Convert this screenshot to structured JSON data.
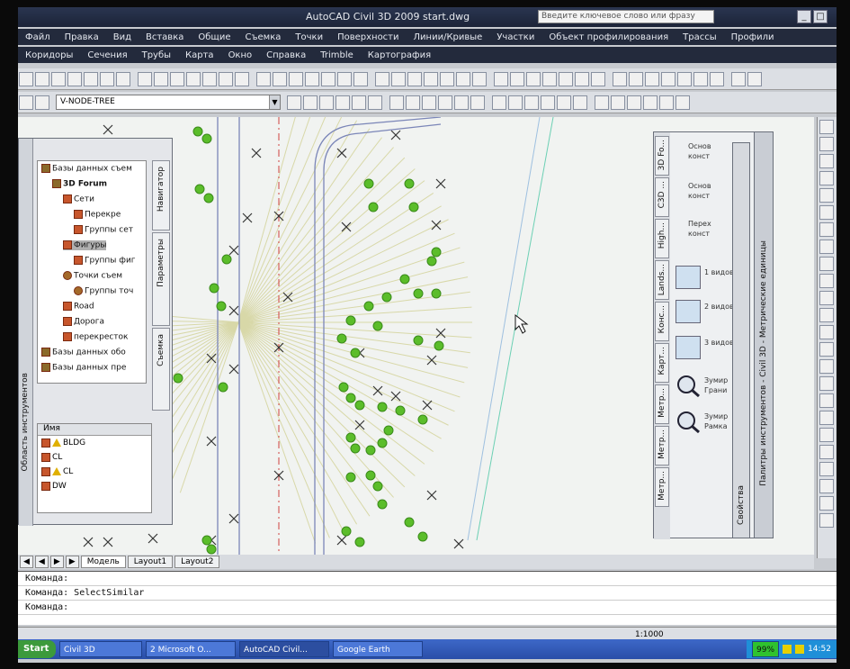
{
  "window": {
    "title": "AutoCAD Civil 3D 2009 start.dwg",
    "search_placeholder": "Введите ключевое слово или фразу",
    "min": "_",
    "max": "□",
    "close": "X"
  },
  "menu1": [
    "Файл",
    "Правка",
    "Вид",
    "Вставка",
    "Общие",
    "Съемка",
    "Точки",
    "Поверхности",
    "Линии/Кривые",
    "Участки",
    "Объект профилирования",
    "Трассы",
    "Профили"
  ],
  "menu2": [
    "Коридоры",
    "Сечения",
    "Трубы",
    "Карта",
    "Окно",
    "Справка",
    "Trimble",
    "Картография"
  ],
  "layer_combo": "V-NODE-TREE",
  "navigator": {
    "vertical_title": "Область инструментов",
    "tree": [
      {
        "label": "Базы данных съем",
        "indent": 0,
        "icon": "db"
      },
      {
        "label": "3D Forum",
        "indent": 1,
        "icon": "db",
        "bold": true
      },
      {
        "label": "Сети",
        "indent": 2,
        "icon": "net"
      },
      {
        "label": "Перекре",
        "indent": 3,
        "icon": "net"
      },
      {
        "label": "Группы сет",
        "indent": 3,
        "icon": "net"
      },
      {
        "label": "Фигуры",
        "indent": 2,
        "icon": "net",
        "selected": true
      },
      {
        "label": "Группы фиг",
        "indent": 3,
        "icon": "net"
      },
      {
        "label": "Точки съем",
        "indent": 2,
        "icon": "pt"
      },
      {
        "label": "Группы точ",
        "indent": 3,
        "icon": "pt"
      },
      {
        "label": "Road",
        "indent": 2,
        "icon": "net"
      },
      {
        "label": "Дорога",
        "indent": 2,
        "icon": "net"
      },
      {
        "label": "перекресток",
        "indent": 2,
        "icon": "net"
      },
      {
        "label": "Базы данных обо",
        "indent": 0,
        "icon": "db"
      },
      {
        "label": "Базы данных пре",
        "indent": 0,
        "icon": "db"
      }
    ],
    "tabs": [
      "Навигатор",
      "Параметры",
      "Съемка"
    ],
    "list_header": "Имя",
    "list": [
      {
        "label": "BLDG",
        "warn": true
      },
      {
        "label": "CL",
        "warn": false
      },
      {
        "label": "CL",
        "warn": true
      },
      {
        "label": "DW",
        "warn": false
      }
    ]
  },
  "palette": {
    "title": "Палитры инструментов - Civil 3D - Метрические единицы",
    "properties_tab": "Свойства",
    "tabs": [
      "3D Fo...",
      "C3D ...",
      "High...",
      "Lands...",
      "Конс...",
      "Карт...",
      "Метр...",
      "Метр...",
      "Метр..."
    ],
    "items": [
      "Основ конст",
      "Основ конст",
      "Перех конст",
      "1 видов",
      "2 видов",
      "3 видов",
      "Зумир Грани",
      "Зумир Рамка"
    ]
  },
  "layout_tabs": [
    "Модель",
    "Layout1",
    "Layout2"
  ],
  "command_lines": [
    "Команда:",
    "Команда: SelectSimilar",
    "Команда:"
  ],
  "status": {
    "scale": "1:1000"
  },
  "taskbar": {
    "start": "Start",
    "tasks": [
      "Civil 3D",
      "2 Microsoft O...",
      "AutoCAD Civil...",
      "Google Earth"
    ],
    "battery": "99%",
    "clock": "14:52"
  }
}
